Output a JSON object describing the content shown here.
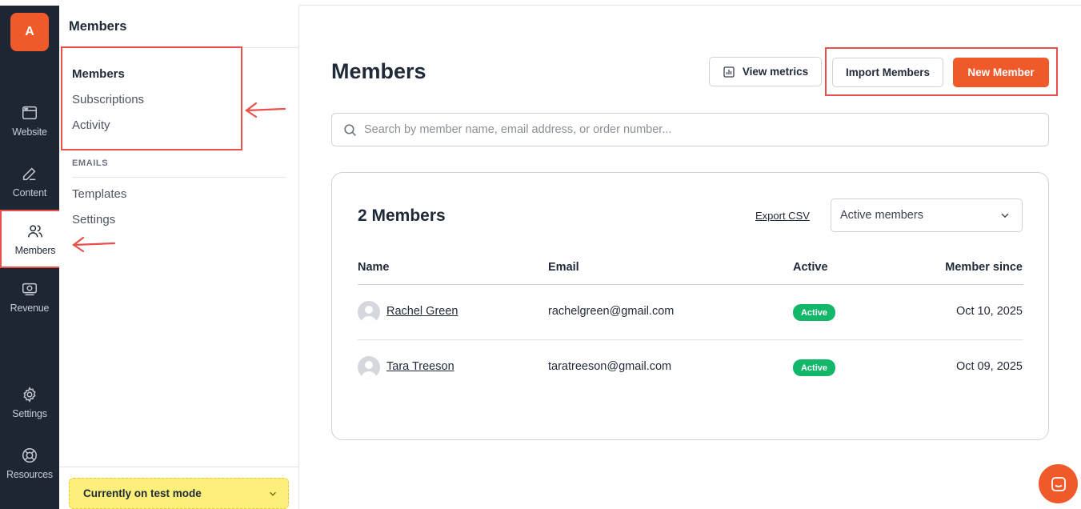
{
  "rail": {
    "avatar_letter": "A",
    "items": [
      {
        "label": "Website",
        "icon": "browser-window-icon"
      },
      {
        "label": "Content",
        "icon": "pencil-icon"
      },
      {
        "label": "Members",
        "icon": "users-icon"
      },
      {
        "label": "Revenue",
        "icon": "money-icon"
      },
      {
        "label": "Settings",
        "icon": "gear-icon"
      },
      {
        "label": "Resources",
        "icon": "lifebuoy-icon"
      }
    ]
  },
  "sidebar": {
    "title": "Members",
    "links": [
      {
        "label": "Members",
        "active": true
      },
      {
        "label": "Subscriptions",
        "active": false
      },
      {
        "label": "Activity",
        "active": false
      }
    ],
    "emails_section": "EMAILS",
    "email_links": [
      {
        "label": "Templates"
      },
      {
        "label": "Settings"
      }
    ],
    "test_mode": "Currently on test mode"
  },
  "header": {
    "title": "Members",
    "view_metrics": "View metrics",
    "import_members": "Import Members",
    "new_member": "New Member"
  },
  "search": {
    "placeholder": "Search by member name, email address, or order number..."
  },
  "members_card": {
    "title": "2 Members",
    "export": "Export CSV",
    "filter": "Active members",
    "columns": [
      "Name",
      "Email",
      "Active",
      "Member since"
    ],
    "rows": [
      {
        "name": "Rachel Green",
        "email": "rachelgreen@gmail.com",
        "status": "Active",
        "since": "Oct 10, 2025"
      },
      {
        "name": "Tara Treeson",
        "email": "taratreeson@gmail.com",
        "status": "Active",
        "since": "Oct 09, 2025"
      }
    ]
  },
  "colors": {
    "accent": "#f05a2a",
    "rail": "#1e2633",
    "active_badge": "#12b76a",
    "annotation": "#e8504a",
    "test_mode": "#fdf07a"
  }
}
